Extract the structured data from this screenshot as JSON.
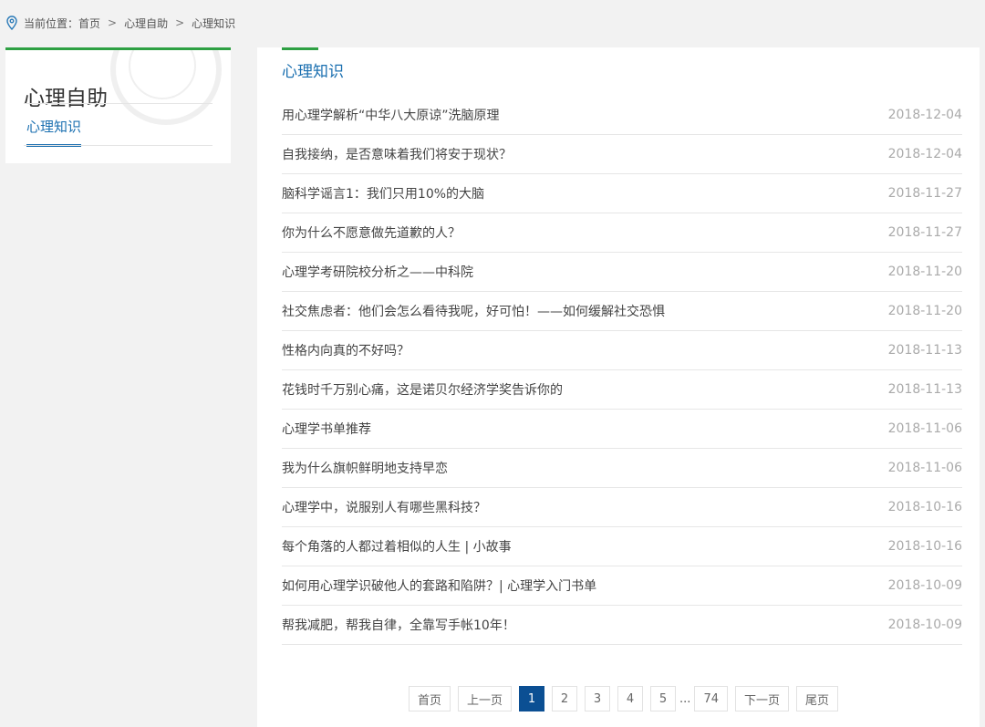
{
  "breadcrumb": {
    "prefix": "当前位置：",
    "home": "首页",
    "sep": ">",
    "level1": "心理自助",
    "level2": "心理知识"
  },
  "sidebar": {
    "title": "心理自助",
    "items": [
      {
        "label": "心理知识"
      }
    ]
  },
  "main": {
    "title": "心理知识",
    "articles": [
      {
        "title": "用心理学解析“中华八大原谅”洗脑原理",
        "date": "2018-12-04"
      },
      {
        "title": "自我接纳，是否意味着我们将安于现状？",
        "date": "2018-12-04"
      },
      {
        "title": "脑科学谣言1：我们只用10%的大脑",
        "date": "2018-11-27"
      },
      {
        "title": "你为什么不愿意做先道歉的人？",
        "date": "2018-11-27"
      },
      {
        "title": "心理学考研院校分析之——中科院",
        "date": "2018-11-20"
      },
      {
        "title": "社交焦虑者：他们会怎么看待我呢，好可怕！——如何缓解社交恐惧",
        "date": "2018-11-20"
      },
      {
        "title": "性格内向真的不好吗？",
        "date": "2018-11-13"
      },
      {
        "title": "花钱时千万别心痛，这是诺贝尔经济学奖告诉你的",
        "date": "2018-11-13"
      },
      {
        "title": "心理学书单推荐",
        "date": "2018-11-06"
      },
      {
        "title": "我为什么旗帜鲜明地支持早恋",
        "date": "2018-11-06"
      },
      {
        "title": "心理学中，说服别人有哪些黑科技？",
        "date": "2018-10-16"
      },
      {
        "title": "每个角落的人都过着相似的人生 | 小故事",
        "date": "2018-10-16"
      },
      {
        "title": "如何用心理学识破他人的套路和陷阱？| 心理学入门书单",
        "date": "2018-10-09"
      },
      {
        "title": "帮我减肥，帮我自律，全靠写手帐10年！",
        "date": "2018-10-09"
      }
    ]
  },
  "pagination": {
    "first": "首页",
    "prev": "上一页",
    "pages": [
      "1",
      "2",
      "3",
      "4",
      "5"
    ],
    "current": "1",
    "ellipsis": "...",
    "last_page": "74",
    "next": "下一页",
    "last": "尾页"
  },
  "colors": {
    "accent_green": "#2ea043",
    "link_blue": "#1a6fb0",
    "active_page": "#0b4f93"
  },
  "icons": {
    "location": "location-pin-icon"
  }
}
